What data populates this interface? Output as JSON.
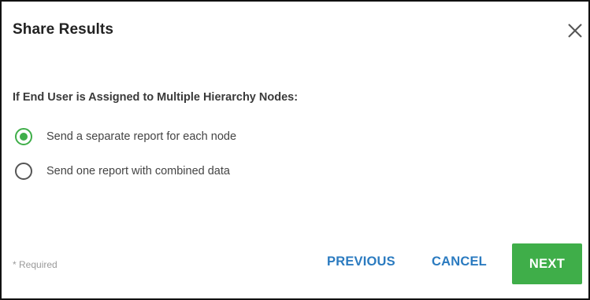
{
  "dialog": {
    "title": "Share Results",
    "close_icon": "close-icon"
  },
  "section": {
    "label": "If End User is Assigned to Multiple Hierarchy Nodes:"
  },
  "options": [
    {
      "label": "Send a separate report for each node",
      "selected": true
    },
    {
      "label": "Send one report with combined data",
      "selected": false
    }
  ],
  "footer": {
    "required_note": "* Required",
    "previous_label": "PREVIOUS",
    "cancel_label": "CANCEL",
    "next_label": "NEXT"
  },
  "colors": {
    "accent_green": "#3fae49",
    "link_blue": "#2b7bc0"
  }
}
